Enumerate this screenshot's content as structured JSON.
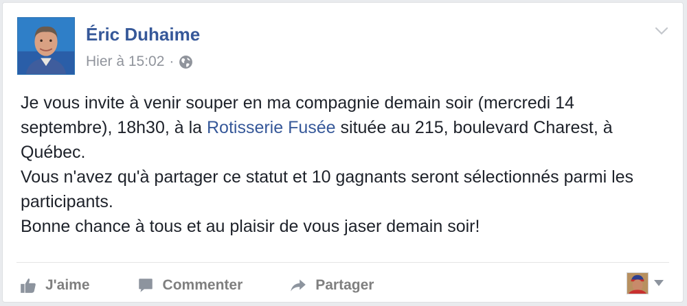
{
  "post": {
    "author": "Éric Duhaime",
    "timestamp": "Hier à 15:02",
    "separator": "·",
    "privacy_icon": "globe-icon",
    "menu_icon": "chevron-down-icon",
    "text": {
      "line1_prefix": "Je vous invite à venir souper en ma compagnie demain soir (mercredi 14 septembre), 18h30, à la ",
      "link": "Rotisserie Fusée",
      "line1_suffix": " située au 215, boulevard Charest, à Québec.",
      "line2": "Vous n'avez qu'à partager ce statut et 10 gagnants seront sélectionnés parmi les participants.",
      "line3": "Bonne chance à tous et au plaisir de vous jaser demain soir!"
    }
  },
  "actions": {
    "like": {
      "label": "J'aime",
      "icon": "thumbs-up-icon"
    },
    "comment": {
      "label": "Commenter",
      "icon": "comment-icon"
    },
    "share": {
      "label": "Partager",
      "icon": "share-arrow-icon"
    }
  },
  "reactor": {
    "icon": "caret-down-icon"
  },
  "colors": {
    "link": "#365899",
    "meta": "#90949c",
    "text": "#1d2129",
    "action": "#7f7f7f"
  }
}
